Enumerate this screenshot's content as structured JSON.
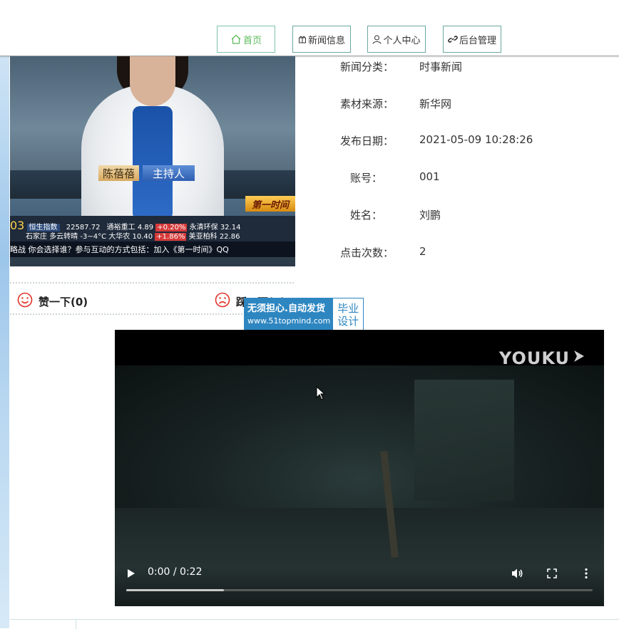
{
  "nav": {
    "items": [
      {
        "label": "首页",
        "icon": "home-icon"
      },
      {
        "label": "新闻信息",
        "icon": "gift-icon"
      },
      {
        "label": "个人中心",
        "icon": "user-icon"
      },
      {
        "label": "后台管理",
        "icon": "link-icon"
      }
    ]
  },
  "news_image": {
    "caption_name": "陈蓓蓓",
    "caption_role": "主持人",
    "channel": "第一时间",
    "ticker_row1": [
      "03",
      "恒生指数",
      "22587.72",
      "通裕重工",
      "4.89",
      "+0.20%",
      "永清环保",
      "32.14"
    ],
    "ticker_row2": [
      "石家庄 多云转晴",
      "-3~4°C",
      "大华农",
      "10.40",
      "+1.86%",
      "美亚柏科",
      "22.86"
    ],
    "ticker_bottom": "略战 你会选择谁？参与互动的方式包括：加入《第一时间》QQ"
  },
  "info": [
    {
      "label": "新闻分类：",
      "value": "时事新闻"
    },
    {
      "label": "素材来源：",
      "value": "新华网"
    },
    {
      "label": "发布日期：",
      "value": "2021-05-09 10:28:26"
    },
    {
      "label": "账号：",
      "value": "001"
    },
    {
      "label": "姓名：",
      "value": "刘鹏"
    },
    {
      "label": "点击次数：",
      "value": "2"
    }
  ],
  "like": {
    "like_label": "赞一下(0)",
    "dislike_label": "踩一下(0)"
  },
  "badge": {
    "line1": "无须担心.自动发货",
    "line2": "www.51topmind.com",
    "right1": "毕业",
    "right2": "设计"
  },
  "video": {
    "brand": "YOUKU",
    "time": "0:00 / 0:22",
    "progress": 0.21
  },
  "colors": {
    "accent": "#5cb85c",
    "nav_border": "#6aa8a0",
    "badge_blue": "#2e86c1"
  }
}
